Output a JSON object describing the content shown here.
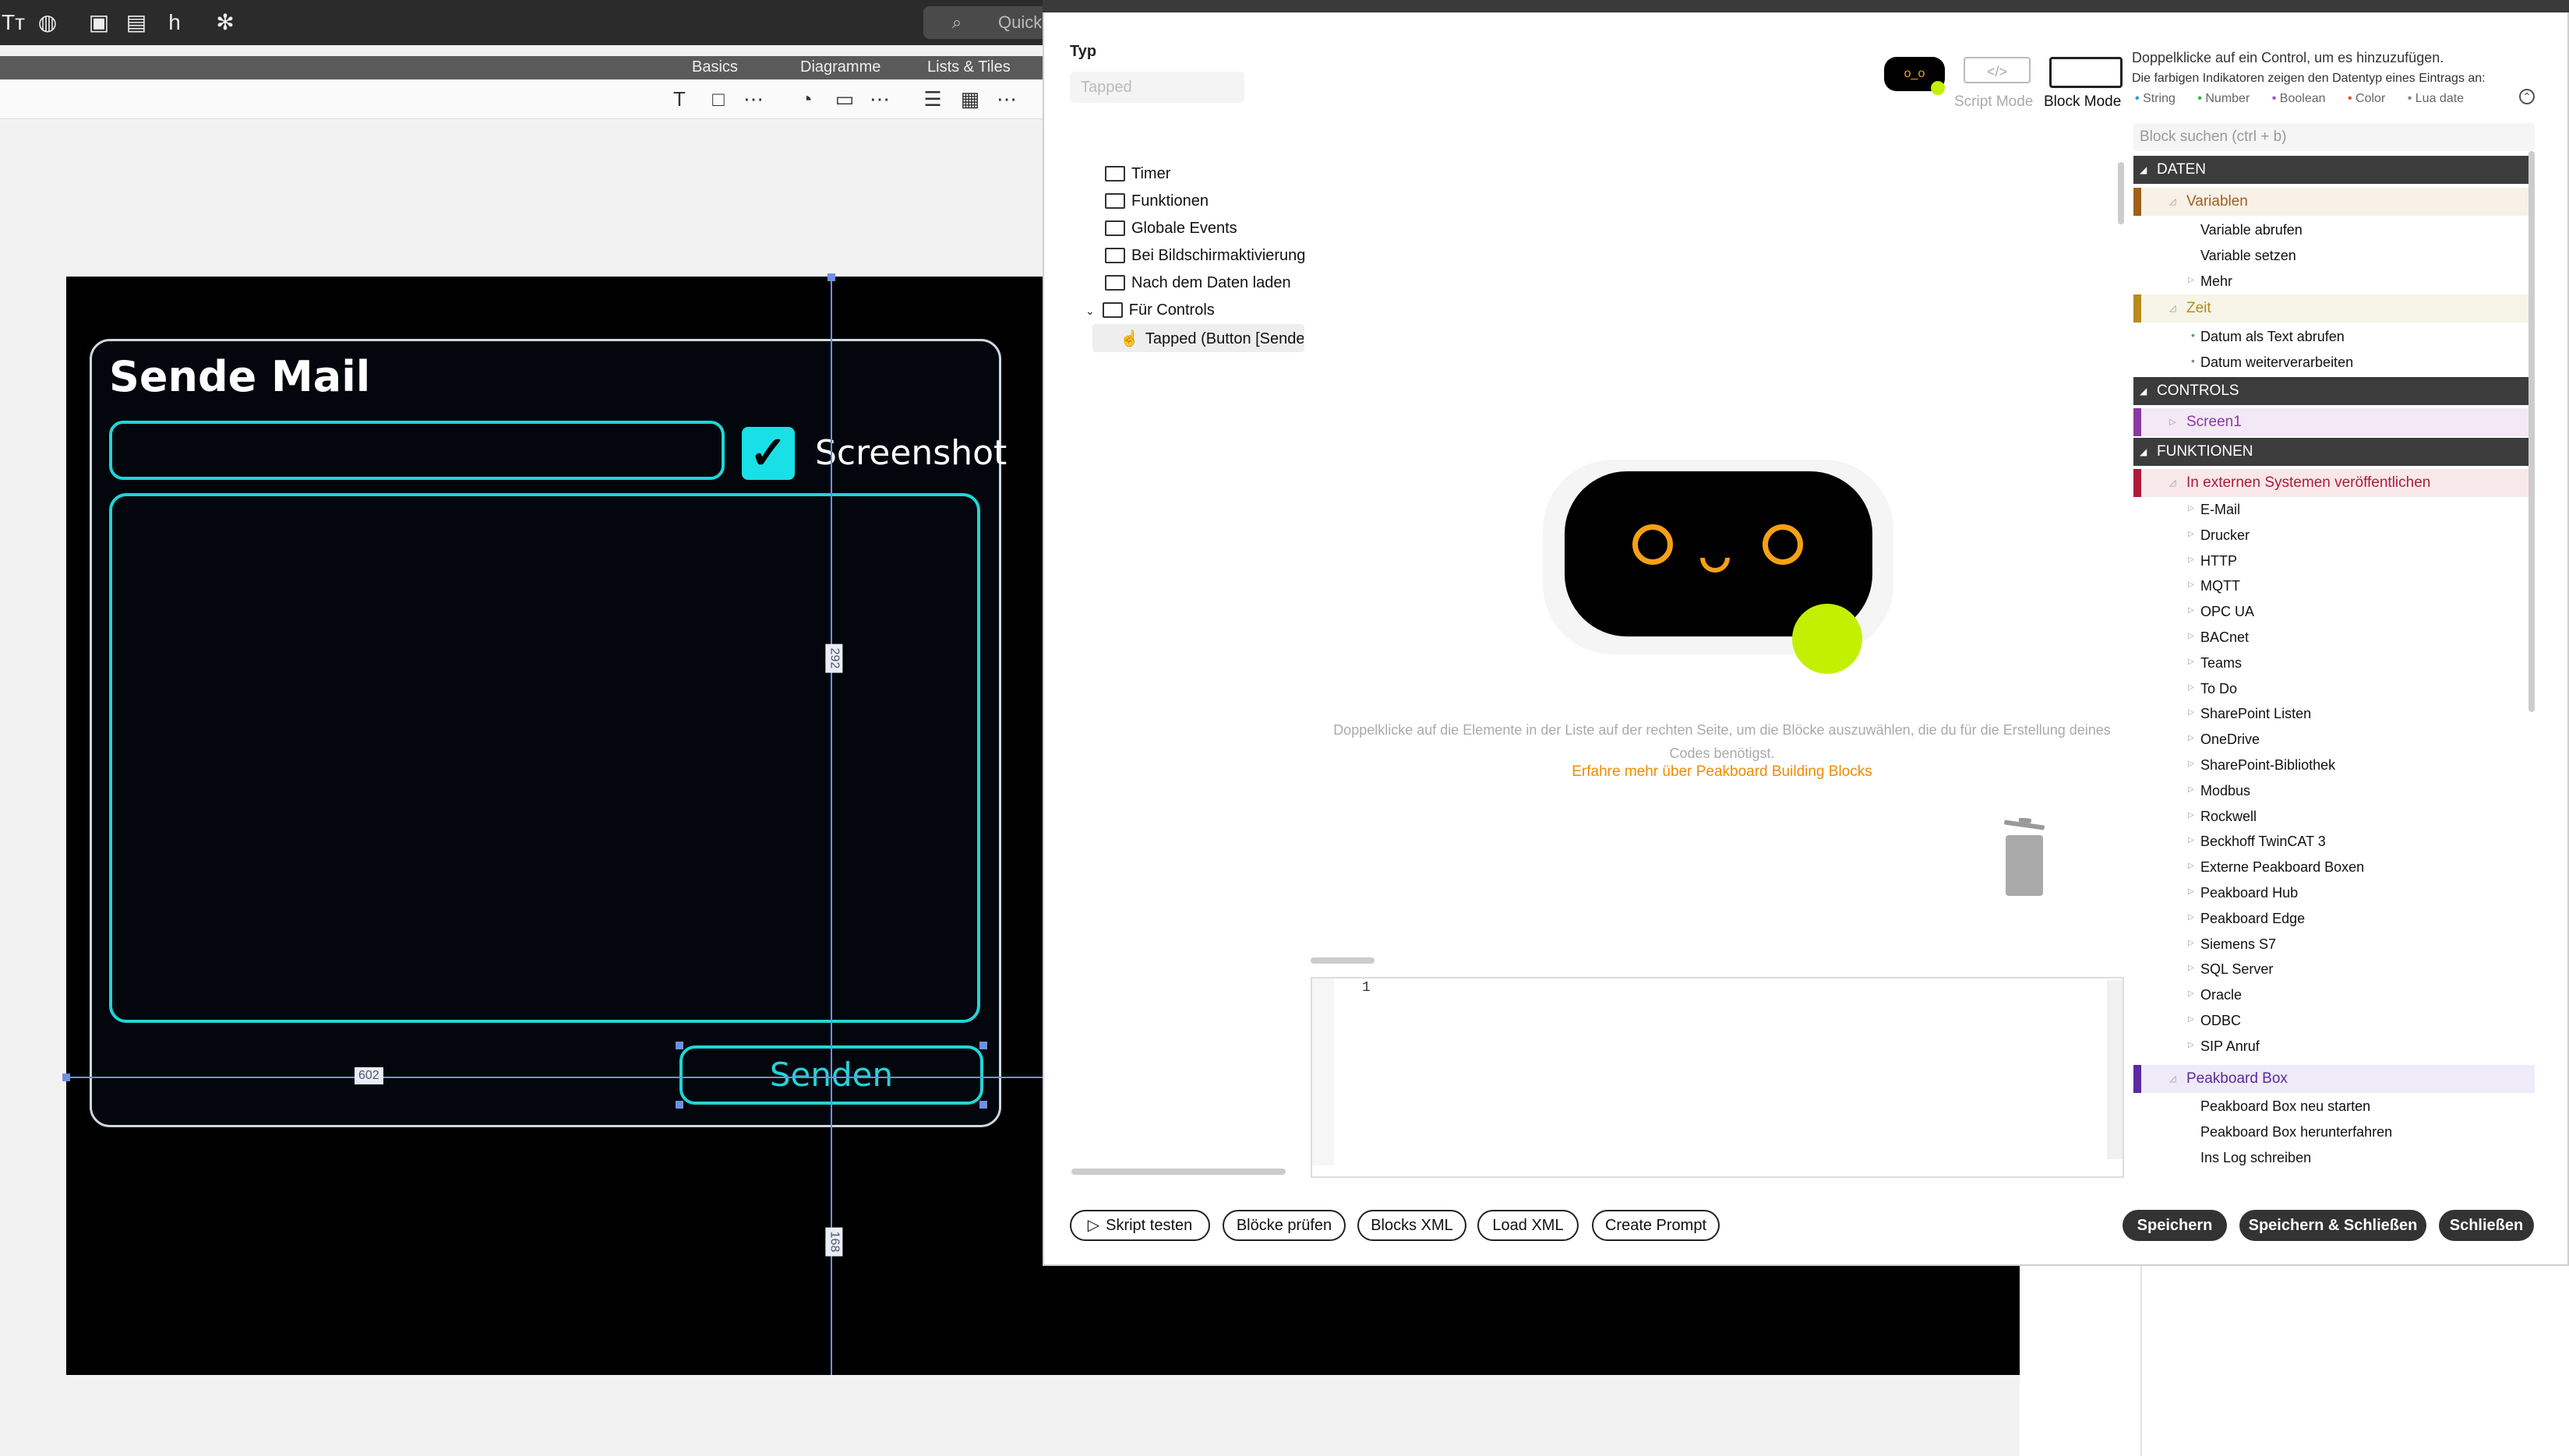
{
  "topbar": {
    "search_placeholder": "Quick"
  },
  "ribbon": {
    "tabs": [
      "Basics",
      "Diagramme",
      "Lists & Tiles"
    ]
  },
  "canvas": {
    "mail_title": "Sende Mail",
    "checkbox_label": "Screenshot",
    "send_button": "Senden",
    "dim_labels": [
      "602",
      "292",
      "168"
    ]
  },
  "editor": {
    "typ_label": "Typ",
    "typ_placeholder": "Tapped",
    "tree": [
      "Timer",
      "Funktionen",
      "Globale Events",
      "Bei Bildschirmaktivierung",
      "Nach dem Daten laden",
      "Für Controls"
    ],
    "tree_selected": "Tapped (Button [Sende",
    "hint": "Doppelklicke auf die Elemente in der Liste auf der rechten Seite, um die Blöcke auszuwählen, die du für die Erstellung deines Codes benötigst.",
    "learn_link": "Erfahre mehr über Peakboard Building Blocks",
    "line_number": "1",
    "mode_script": "Script Mode",
    "mode_block": "Block Mode",
    "info_line1": "Doppelklicke auf ein Control, um es hinzuzufügen.",
    "info_line2": "Die farbigen Indikatoren zeigen den Datentyp eines Eintrags an:",
    "types": [
      "String",
      "Number",
      "Boolean",
      "Color",
      "Lua date"
    ],
    "type_colors": [
      "#2aa0d8",
      "#3ab34a",
      "#9a5bd0",
      "#e0553a",
      "#8a8a8a"
    ],
    "block_search": "Block suchen (ctrl + b)",
    "buttons_left": [
      "Skript testen",
      "Blöcke prüfen",
      "Blocks XML",
      "Load XML",
      "Create Prompt"
    ],
    "buttons_right": [
      "Speichern",
      "Speichern & Schließen",
      "Schließen"
    ]
  },
  "blocks": {
    "daten": "DATEN",
    "variablen": "Variablen",
    "var_items": [
      "Variable abrufen",
      "Variable setzen",
      "Mehr"
    ],
    "zeit": "Zeit",
    "zeit_items": [
      "Datum als Text abrufen",
      "Datum weiterverarbeiten"
    ],
    "controls": "CONTROLS",
    "screen1": "Screen1",
    "funktionen": "FUNKTIONEN",
    "extern": "In externen Systemen veröffentlichen",
    "extern_items": [
      "E-Mail",
      "Drucker",
      "HTTP",
      "MQTT",
      "OPC UA",
      "BACnet",
      "Teams",
      "To Do",
      "SharePoint Listen",
      "OneDrive",
      "SharePoint-Bibliothek",
      "Modbus",
      "Rockwell",
      "Beckhoff TwinCAT 3",
      "Externe Peakboard Boxen",
      "Peakboard Hub",
      "Peakboard Edge",
      "Siemens S7",
      "SQL Server",
      "Oracle",
      "ODBC",
      "SIP Anruf"
    ],
    "pbbox": "Peakboard Box",
    "pbbox_items": [
      "Peakboard Box neu starten",
      "Peakboard Box herunterfahren",
      "Ins Log schreiben"
    ]
  }
}
